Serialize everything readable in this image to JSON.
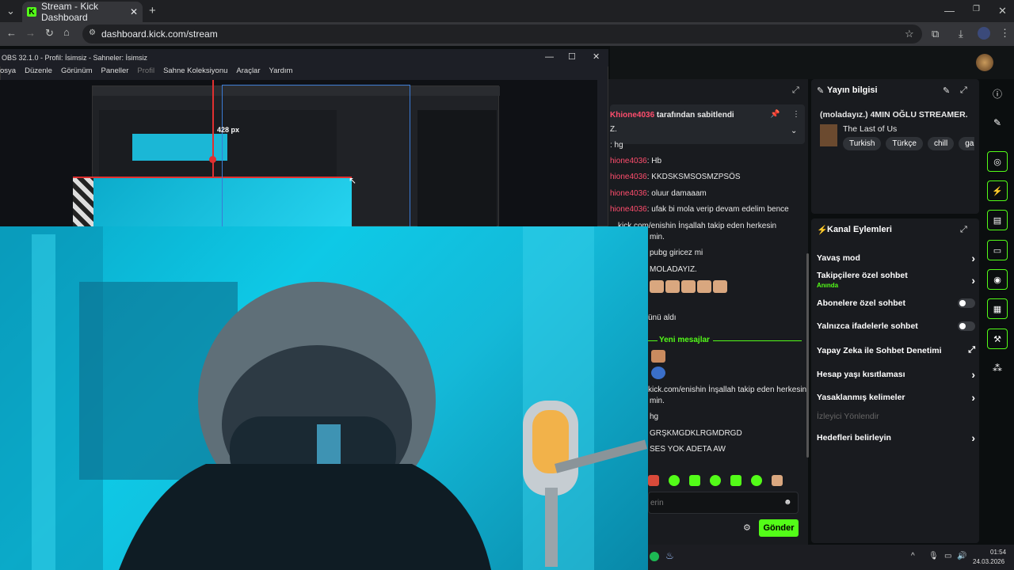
{
  "browser": {
    "tab_title": "Stream - Kick Dashboard",
    "url": "dashboard.kick.com/stream"
  },
  "obs": {
    "title": "OBS 32.1.0 - Profil: İsimsiz - Sahneler: İsimsiz",
    "menu": [
      "osya",
      "Düzenle",
      "Görünüm",
      "Paneller",
      "Sahne Koleksiyonu",
      "Araçlar",
      "Yardım"
    ],
    "profil_label": "Profil",
    "measure_label": "428 px"
  },
  "chat": {
    "pinned_by": "tarafından sabitlendi",
    "pinned_user": "Khione4036",
    "pinned_text": "Z.",
    "lines": [
      {
        "user": "",
        "text": ": hg"
      },
      {
        "user": "hione4036",
        "text": ": Hb"
      },
      {
        "user": "hione4036",
        "text": ": KKDSKSMSOSMZPSÖS"
      },
      {
        "user": "hione4036",
        "text": ": oluur damaaam"
      },
      {
        "user": "hione4036",
        "text": ": ufak bi mola verip devam edelim bence"
      }
    ],
    "link_line_1": "kick.com/enishin İnşallah takip eden herkesin",
    "link_line_1_cont": "min.",
    "line_pubg": "pubg giricez mi",
    "line_moladayiz": "MOLADAYIZ.",
    "line_gift": "ünü aldı",
    "new_messages": "Yeni mesajlar",
    "link_line_2": "kick.com/enishin İnşallah takip eden herkesin",
    "link_line_2_cont": "min.",
    "line_hg": "hg",
    "line_grskm": "GRŞKMGDKLRGMDRGD",
    "line_ses": "SES YOK ADETA AW",
    "input_placeholder": "erin",
    "send_label": "Gönder"
  },
  "stream_info": {
    "title": "Yayın bilgisi",
    "stream_title": "(moladayız.) 4MIN OĞLU STREAMER.",
    "category": "The Last of Us",
    "tags": [
      "Turkish",
      "Türkçe",
      "chill",
      "gamin"
    ]
  },
  "channel_actions": {
    "title": "Kanal Eylemleri",
    "items": [
      {
        "label": "Yavaş mod",
        "control": "chevron"
      },
      {
        "label": "Takipçilere özel sohbet",
        "sub": "Anında",
        "control": "chevron"
      },
      {
        "label": "Abonelere özel sohbet",
        "control": "toggle"
      },
      {
        "label": "Yalnızca ifadelerle sohbet",
        "control": "toggle"
      },
      {
        "label": "Yapay Zeka ile Sohbet Denetimi",
        "control": "external"
      },
      {
        "label": "Hesap yaşı kısıtlaması",
        "control": "chevron"
      },
      {
        "label": "Yasaklanmış kelimeler",
        "control": "chevron"
      },
      {
        "label": "İzleyici Yönlendir",
        "control": "none",
        "disabled": true
      },
      {
        "label": "Hedefleri belirleyin",
        "control": "chevron"
      }
    ]
  },
  "taskbar": {
    "time": "01:54",
    "date": "24.03.2026"
  },
  "colors": {
    "kick_green": "#53fc18",
    "username_red": "#ff4d6d",
    "panel_bg": "#191b1f"
  }
}
